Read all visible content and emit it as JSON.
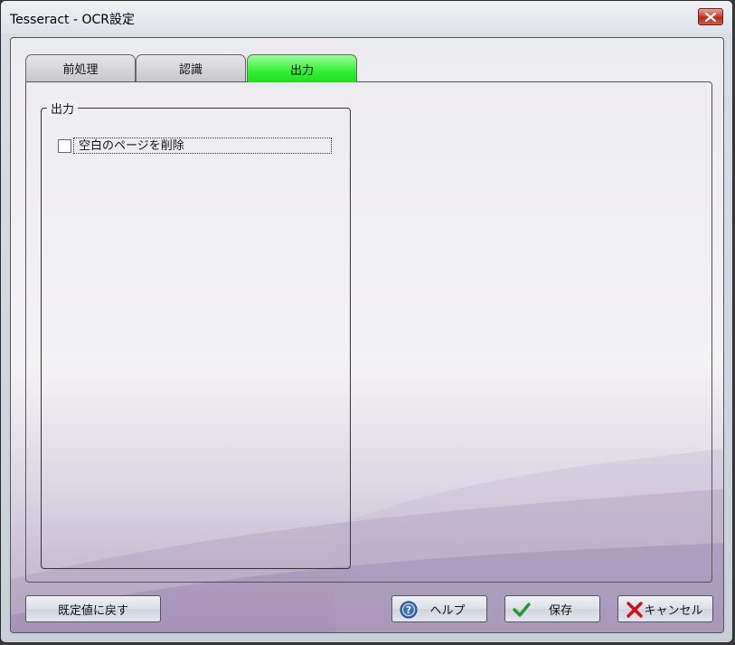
{
  "window": {
    "title": "Tesseract - OCR設定"
  },
  "tabs": [
    {
      "label": "前処理",
      "active": false
    },
    {
      "label": "認識",
      "active": false
    },
    {
      "label": "出力",
      "active": true
    }
  ],
  "output_group": {
    "legend": "出力",
    "delete_blank_pages": {
      "label": "空白のページを削除",
      "checked": false
    }
  },
  "buttons": {
    "reset": "既定値に戻す",
    "help": "ヘルプ",
    "save": "保存",
    "cancel": "キャンセル"
  },
  "colors": {
    "active_tab": "#33ee33",
    "close_button": "#c9483b",
    "help_icon": "#3a6fb5",
    "save_icon": "#1f9a2f",
    "cancel_icon": "#cc1111"
  }
}
